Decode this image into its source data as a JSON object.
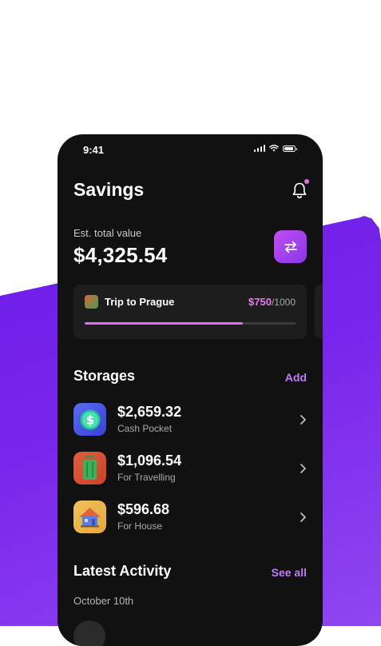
{
  "status_bar": {
    "time": "9:41"
  },
  "header": {
    "title": "Savings"
  },
  "summary": {
    "label": "Est. total value",
    "value": "$4,325.54"
  },
  "goal": {
    "name": "Trip to Prague",
    "saved": "$750",
    "target": "/1000",
    "progress_fraction": 0.75
  },
  "storages": {
    "title": "Storages",
    "add_label": "Add",
    "items": [
      {
        "amount": "$2,659.32",
        "label": "Cash Pocket",
        "icon": "dollar-coin-icon"
      },
      {
        "amount": "$1,096.54",
        "label": "For Travelling",
        "icon": "suitcase-icon"
      },
      {
        "amount": "$596.68",
        "label": "For House",
        "icon": "house-icon"
      }
    ]
  },
  "activity": {
    "title": "Latest Activity",
    "see_all_label": "See all",
    "date": "October 10th"
  },
  "colors": {
    "accent": "#c07cf5",
    "progress": "#e66bee",
    "background_shape": "#7a25ec",
    "phone_background": "#111111"
  }
}
